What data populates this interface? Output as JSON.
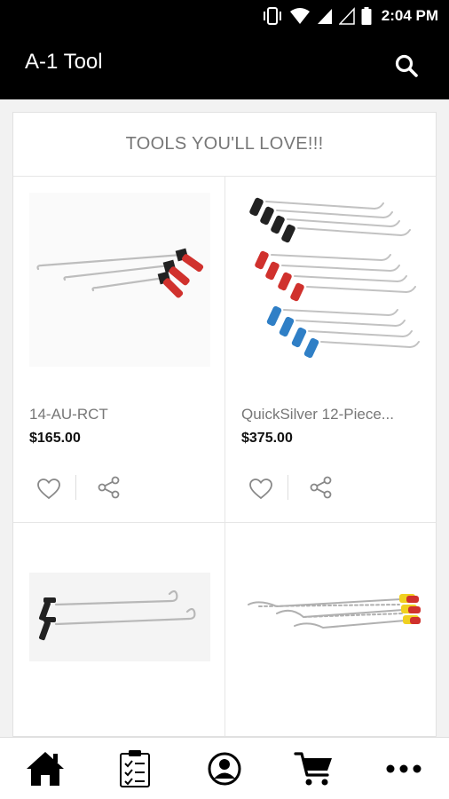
{
  "status_bar": {
    "time": "2:04 PM",
    "icons": [
      "vibrate-icon",
      "wifi-icon",
      "signal-icon",
      "signal-empty-icon",
      "battery-icon"
    ]
  },
  "app_bar": {
    "title": "A-1 Tool",
    "search_icon": "search-icon"
  },
  "section": {
    "title": "TOOLS YOU'LL LOVE!!!"
  },
  "products": [
    {
      "name": "14-AU-RCT",
      "price": "$165.00"
    },
    {
      "name": "QuickSilver 12-Piece...",
      "price": "$375.00"
    },
    {
      "name": "",
      "price": ""
    },
    {
      "name": "",
      "price": ""
    }
  ],
  "bottom_nav": {
    "items": [
      "home-icon",
      "clipboard-checklist-icon",
      "account-icon",
      "cart-icon",
      "more-icon"
    ]
  },
  "colors": {
    "bar_background": "#000000",
    "accent_red": "#d0312d",
    "accent_blue": "#2f7fc6",
    "text_muted": "#777777"
  }
}
